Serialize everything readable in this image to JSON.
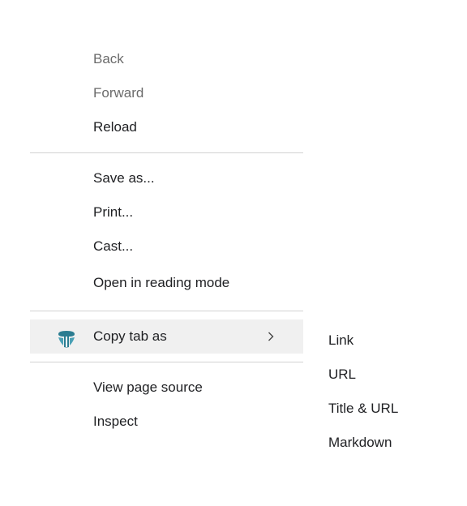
{
  "context_menu": {
    "group1": [
      {
        "label": "Back",
        "disabled": true
      },
      {
        "label": "Forward",
        "disabled": true
      },
      {
        "label": "Reload",
        "disabled": false
      }
    ],
    "group2": [
      {
        "label": "Save as..."
      },
      {
        "label": "Print..."
      },
      {
        "label": "Cast..."
      },
      {
        "label": "Open in reading mode"
      }
    ],
    "copy_tab": {
      "label": "Copy tab as",
      "icon": "extension-logo-icon",
      "icon_colors": [
        "#2b7c91",
        "#4aa0b5"
      ]
    },
    "group4": [
      {
        "label": "View page source"
      },
      {
        "label": "Inspect"
      }
    ]
  },
  "submenu": {
    "items": [
      {
        "label": "Link"
      },
      {
        "label": "URL"
      },
      {
        "label": "Title & URL"
      },
      {
        "label": "Markdown"
      }
    ]
  },
  "colors": {
    "highlight_bg": "#f0f0f0",
    "separator": "#d2d2d2",
    "disabled_text": "#6b6b6b",
    "text": "#202124"
  }
}
